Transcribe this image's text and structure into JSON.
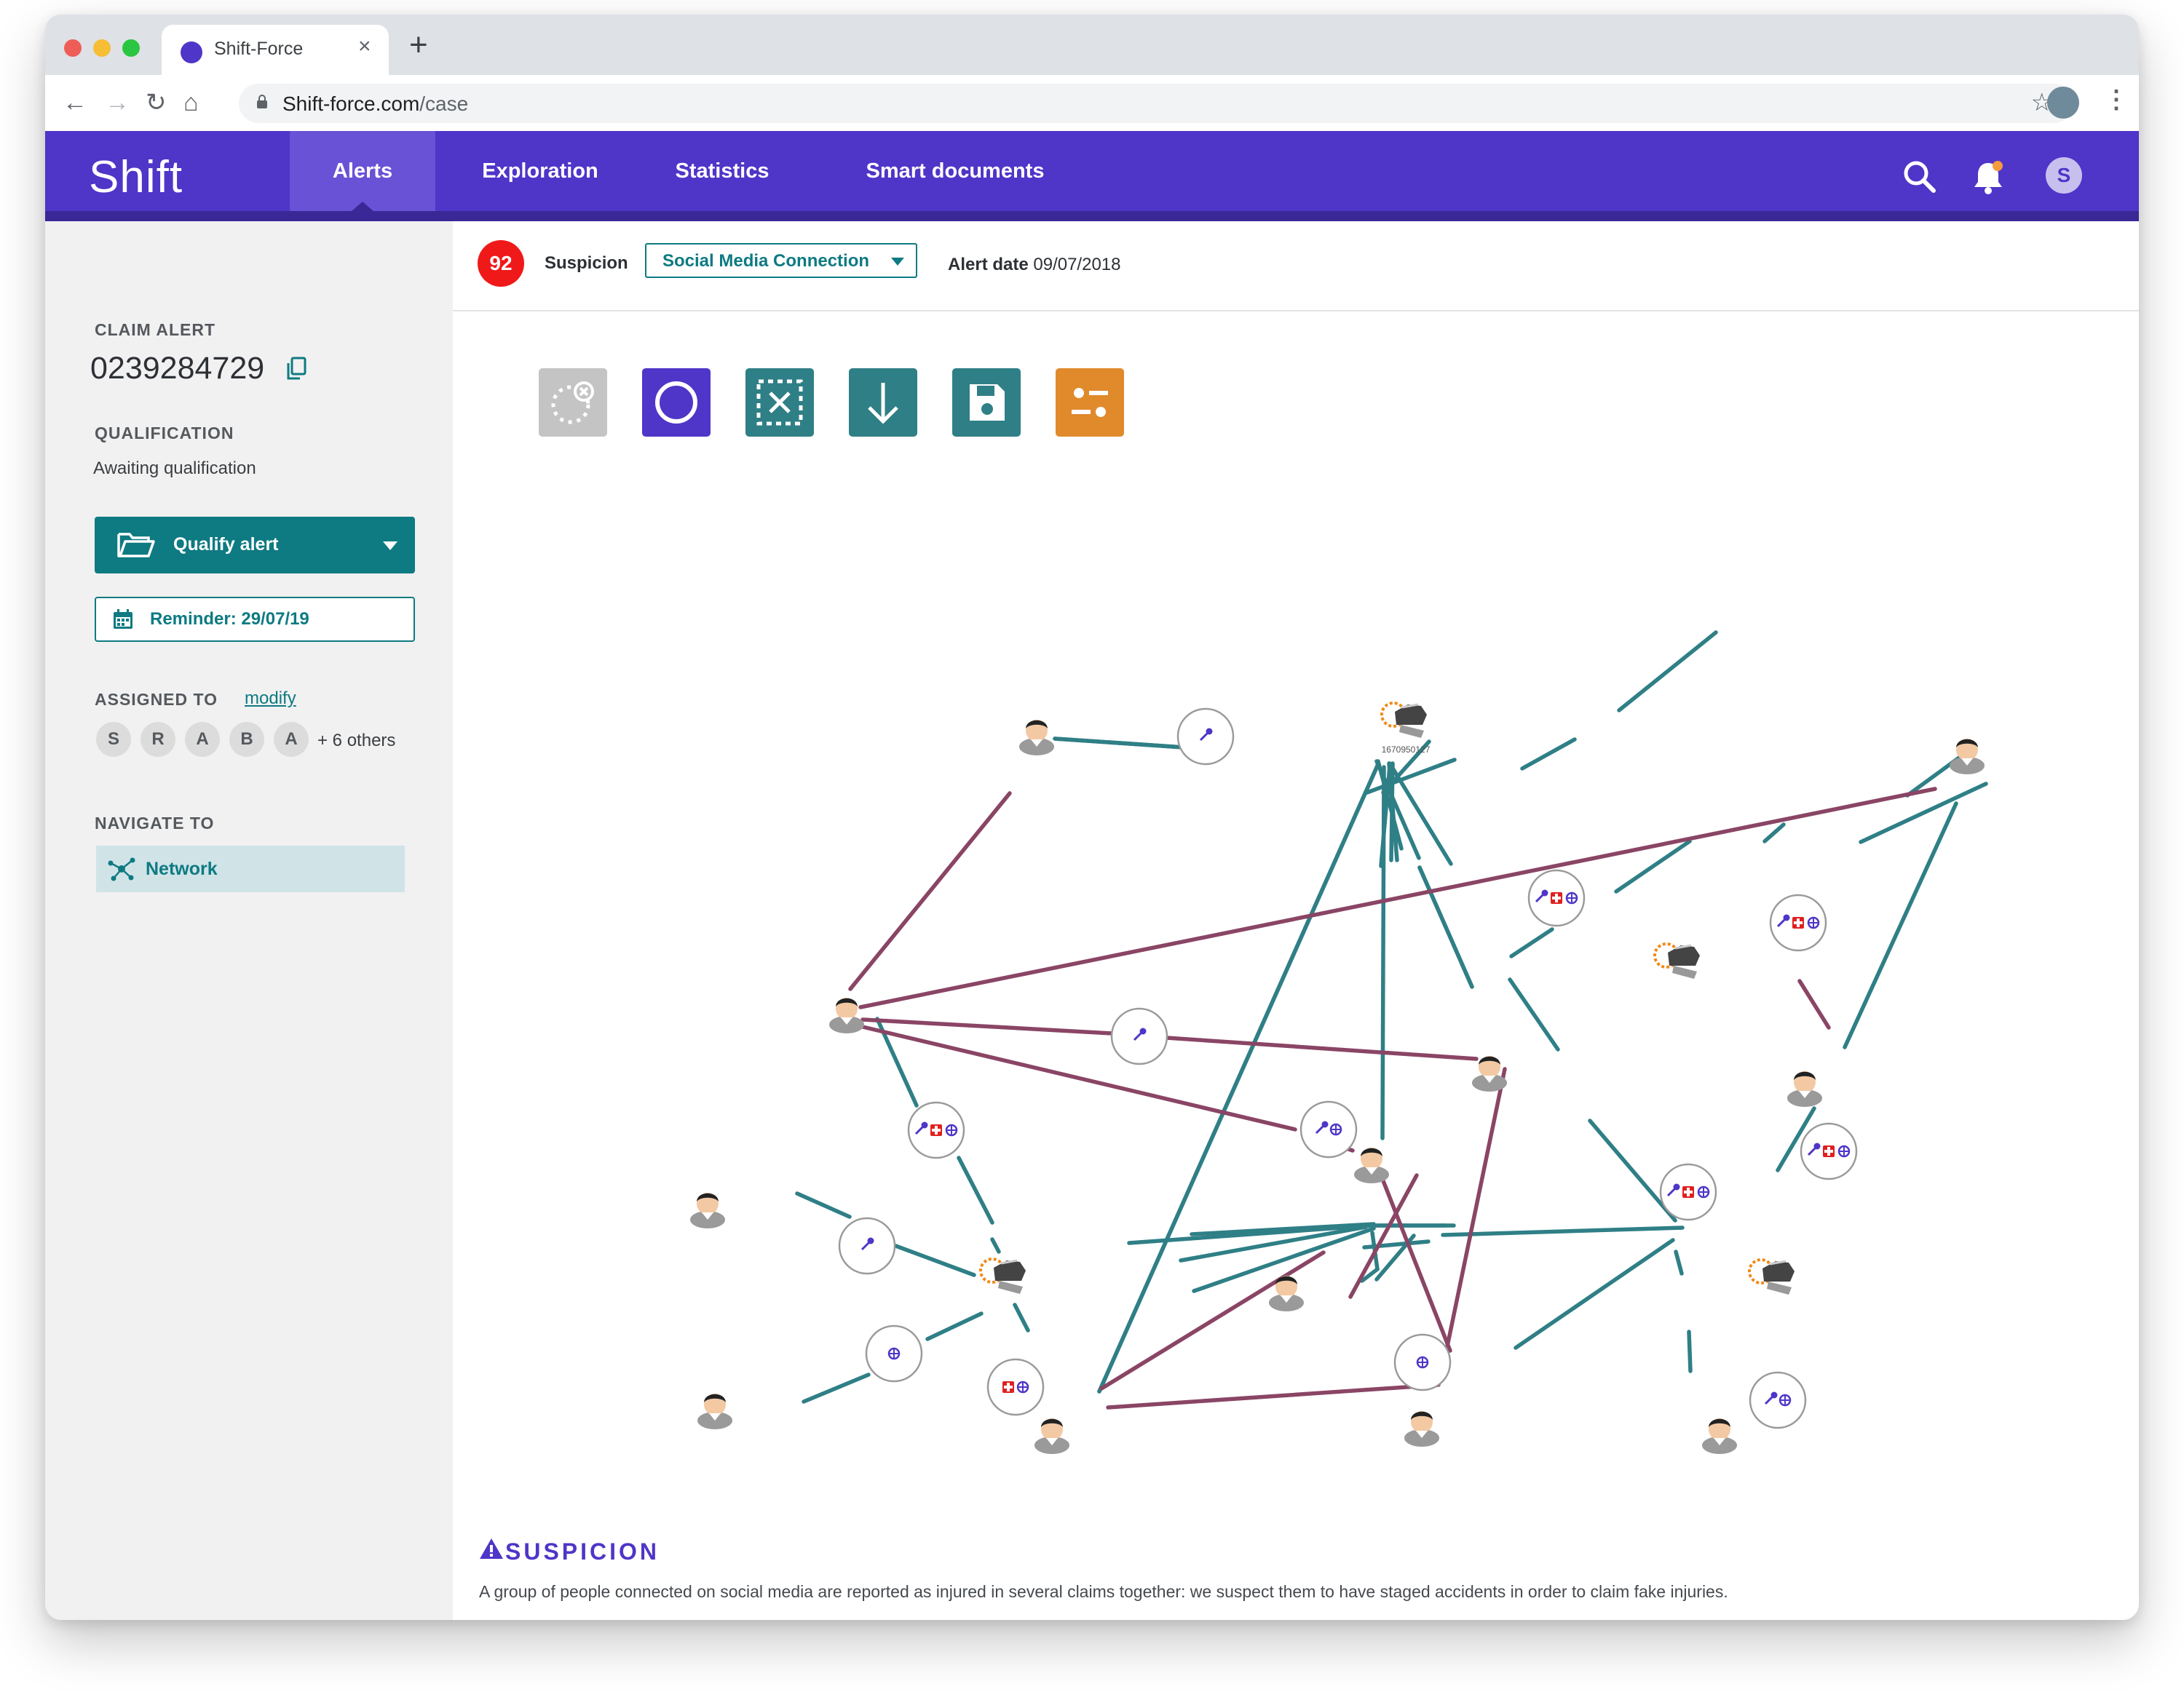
{
  "browser": {
    "tab_title": "Shift-Force",
    "url_host": "Shift-force.com",
    "url_path": "/case"
  },
  "header": {
    "logo": "Shift",
    "nav": [
      {
        "label": "Alerts",
        "active": true
      },
      {
        "label": "Exploration",
        "active": false
      },
      {
        "label": "Statistics",
        "active": false
      },
      {
        "label": "Smart documents",
        "active": false
      }
    ],
    "user_initial": "S"
  },
  "sidebar": {
    "claim_alert_label": "CLAIM ALERT",
    "claim_number": "0239284729",
    "qualification_label": "QUALIFICATION",
    "qualification_value": "Awaiting qualification",
    "qualify_button": "Qualify alert",
    "reminder_button": "Reminder: 29/07/19",
    "assigned_label": "ASSIGNED TO",
    "modify_link": "modify",
    "assignees": [
      "S",
      "R",
      "A",
      "B",
      "A"
    ],
    "others": "+ 6 others",
    "navigate_label": "NAVIGATE TO",
    "network_link": "Network"
  },
  "alert": {
    "score": "92",
    "suspicion_label": "Suspicion",
    "suspicion_value": "Social Media Connection",
    "date_label": "Alert date",
    "date_value": "09/07/2018"
  },
  "toolbar": {
    "tools": [
      {
        "name": "clear-selection",
        "color": "#c4c4c4"
      },
      {
        "name": "circle-select",
        "color": "#4f35c8"
      },
      {
        "name": "box-deselect",
        "color": "#2f7f86"
      },
      {
        "name": "download",
        "color": "#2f7f86"
      },
      {
        "name": "save",
        "color": "#2f7f86"
      },
      {
        "name": "settings-sliders",
        "color": "#e08a2c"
      }
    ]
  },
  "network": {
    "car_label": "1670950127",
    "colors": {
      "teal": "#2f7f86",
      "plum": "#8a4565"
    }
  },
  "suspicion": {
    "title": "SUSPICION",
    "description": "A group of people connected on social media are reported as injured in several claims together: we suspect them to have staged accidents in order to claim fake injuries."
  }
}
